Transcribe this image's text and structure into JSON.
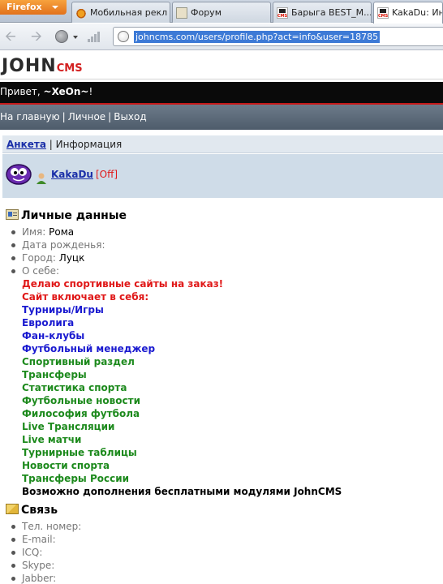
{
  "browser": {
    "app_button": "Firefox",
    "tabs": [
      {
        "title": "Мобильная рекл",
        "icon": "cart-icon"
      },
      {
        "title": "Форум",
        "icon": "forum-icon"
      },
      {
        "title": "Барыга BEST_M...",
        "icon": "cms-icon"
      },
      {
        "title": "KakaDu: Инф",
        "icon": "cms-icon"
      }
    ],
    "url": "johncms.com/users/profile.php?act=info&user=18785"
  },
  "site": {
    "logo_main": "JOHN",
    "logo_sub": "CMS",
    "greeting": "Привет, ",
    "greeting_user": "~XeOn~",
    "greeting_end": "!",
    "menu": [
      "На главную",
      "Личное",
      "Выход"
    ],
    "menu_sep": "|"
  },
  "profile": {
    "tab_profile": "Анкета",
    "tab_sep": " | ",
    "tab_info": "Информация",
    "username": "KakaDu",
    "status": "[Off]"
  },
  "personal": {
    "title": "Личные данные",
    "fields": [
      {
        "label": "Имя:",
        "value": "Рома"
      },
      {
        "label": "Дата рожденья:",
        "value": ""
      },
      {
        "label": "Город:",
        "value": "Луцк"
      },
      {
        "label": "О себе:",
        "value": ""
      }
    ],
    "about": [
      {
        "text": "Делаю спортивные сайты на заказ!",
        "color": "#e01818"
      },
      {
        "text": "Сайт включает в себя:",
        "color": "#e01818"
      },
      {
        "text": "Турниры/Игры",
        "color": "#1a1ad0"
      },
      {
        "text": "Евролига",
        "color": "#1a1ad0"
      },
      {
        "text": "Фан-клубы",
        "color": "#1a1ad0"
      },
      {
        "text": "Футбольный менеджер",
        "color": "#1a1ad0"
      },
      {
        "text": "Спортивный раздел",
        "color": "#1d8a1d"
      },
      {
        "text": "Трансферы",
        "color": "#1d8a1d"
      },
      {
        "text": "Статистика спорта",
        "color": "#1d8a1d"
      },
      {
        "text": "Футбольные новости",
        "color": "#1d8a1d"
      },
      {
        "text": "Философия футбола",
        "color": "#1d8a1d"
      },
      {
        "text": "Live Трансляции",
        "color": "#1d8a1d"
      },
      {
        "text": "Live матчи",
        "color": "#1d8a1d"
      },
      {
        "text": "Турнирные таблицы",
        "color": "#1d8a1d"
      },
      {
        "text": "Новости спорта",
        "color": "#1d8a1d"
      },
      {
        "text": "Трансферы России",
        "color": "#1d8a1d"
      },
      {
        "text": "Возможно дополнения бесплатными модулями JohnCMS",
        "color": "#000000"
      }
    ]
  },
  "contact": {
    "title": "Связь",
    "fields": [
      {
        "label": "Тел. номер:"
      },
      {
        "label": "E-mail:"
      },
      {
        "label": "ICQ:"
      },
      {
        "label": "Skype:"
      },
      {
        "label": "Jabber:"
      }
    ]
  }
}
